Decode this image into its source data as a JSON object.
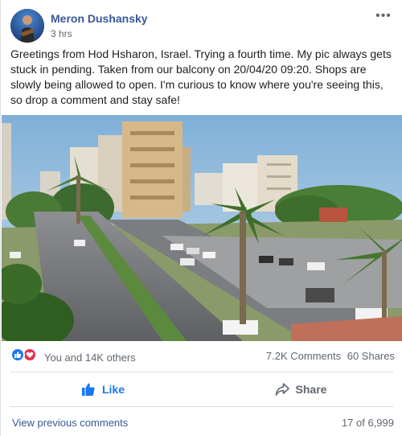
{
  "post": {
    "author": "Meron Dushansky",
    "time": "3 hrs",
    "text": "Greetings from Hod Hsharon, Israel. Trying a fourth time. My pic always gets stuck in pending. Taken from our balcony on 20/04/20 09:20. Shops are slowly being allowed to open. I'm curious to know where you're seeing this, so drop a comment and stay safe!",
    "more_icon": "more-options-icon",
    "more_glyph": "•••"
  },
  "stats": {
    "reactions_text": "You and 14K others",
    "comments": "7.2K Comments",
    "shares": "60 Shares",
    "reaction_icons": [
      "like-reaction-icon",
      "love-reaction-icon"
    ]
  },
  "actions": {
    "like_label": "Like",
    "share_label": "Share"
  },
  "comments": {
    "view_previous": "View previous comments",
    "count": "17 of 6,999"
  },
  "colors": {
    "link_blue": "#385898",
    "like_blue": "#1877f2",
    "love_red": "#e4314e",
    "secondary_text": "#606770"
  }
}
